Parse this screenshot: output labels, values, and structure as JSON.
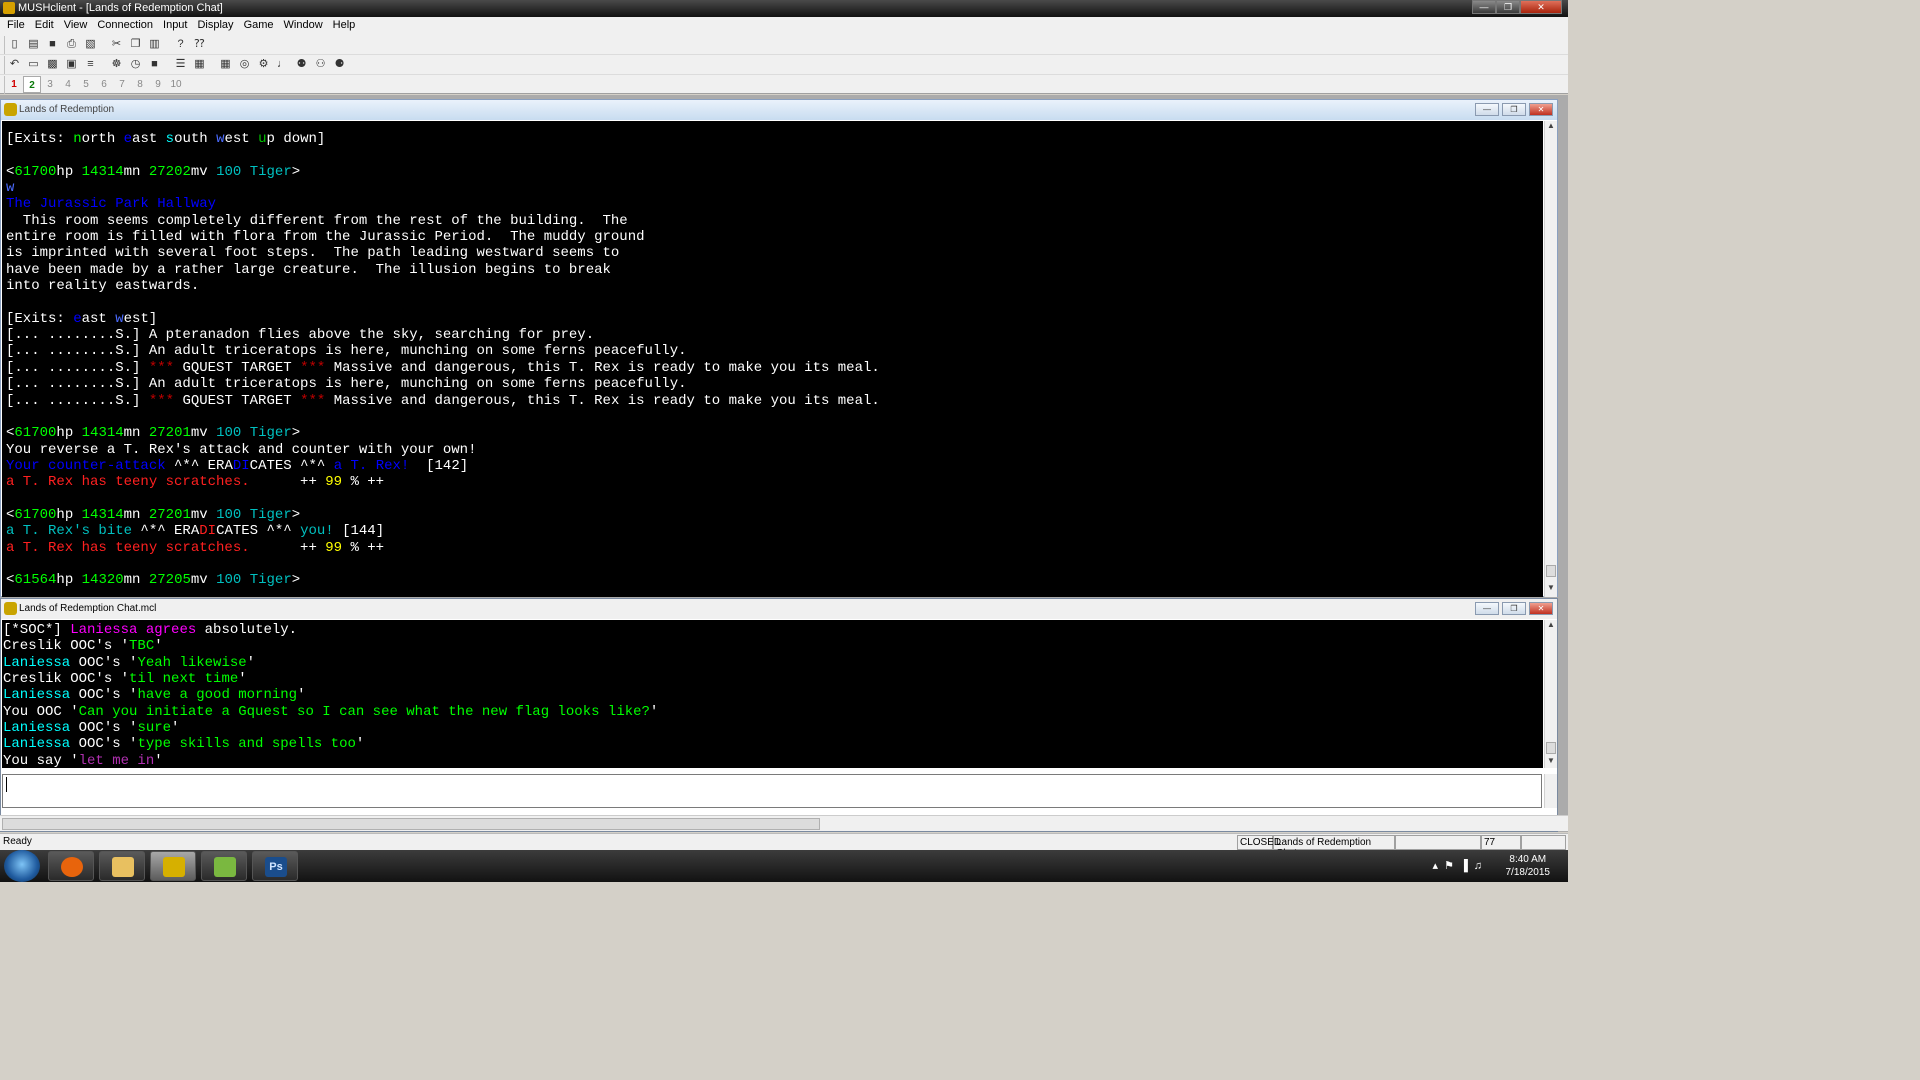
{
  "window": {
    "title": "MUSHclient - [Lands of Redemption Chat]"
  },
  "menu": [
    "File",
    "Edit",
    "View",
    "Connection",
    "Input",
    "Display",
    "Game",
    "Window",
    "Help"
  ],
  "toolbar": {
    "row1_icons": [
      "new-document-icon",
      "open-folder-icon",
      "save-icon",
      "print-icon",
      "print-preview-icon",
      "cut-icon",
      "copy-icon",
      "paste-icon",
      "help-icon",
      "context-help-icon"
    ],
    "row2_icons": [
      "connect-icon",
      "notepad-icon",
      "log-icon",
      "configure-icon",
      "triggers-icon",
      "aliases-icon",
      "timers-icon",
      "immediate-icon",
      "scripts-icon",
      "output-icon",
      "reset-icon",
      "info-icon",
      "world-icon",
      "sound-icon",
      "find-icon",
      "find-again-icon",
      "map-icon"
    ]
  },
  "world_tabs": [
    "1",
    "2",
    "3",
    "4",
    "5",
    "6",
    "7",
    "8",
    "9",
    "10"
  ],
  "world_window": {
    "title": "Lands of Redemption",
    "lines": [
      [
        {
          "t": "[Exits: ",
          "c": "w"
        },
        {
          "t": "n",
          "c": "lg"
        },
        {
          "t": "orth ",
          "c": "w"
        },
        {
          "t": "e",
          "c": "bl"
        },
        {
          "t": "ast ",
          "c": "w"
        },
        {
          "t": "s",
          "c": "lc"
        },
        {
          "t": "outh ",
          "c": "w"
        },
        {
          "t": "w",
          "c": "lb"
        },
        {
          "t": "est ",
          "c": "w"
        },
        {
          "t": "u",
          "c": "gr"
        },
        {
          "t": "p ",
          "c": "w"
        },
        {
          "t": "d",
          "c": "w"
        },
        {
          "t": "own]",
          "c": "w"
        }
      ],
      [],
      [
        {
          "t": "<",
          "c": "w"
        },
        {
          "t": "61700",
          "c": "lg"
        },
        {
          "t": "hp ",
          "c": "w"
        },
        {
          "t": "14314",
          "c": "lg"
        },
        {
          "t": "mn ",
          "c": "w"
        },
        {
          "t": "27202",
          "c": "lg"
        },
        {
          "t": "mv ",
          "c": "w"
        },
        {
          "t": "100 Tiger",
          "c": "cy"
        },
        {
          "t": ">",
          "c": "w"
        }
      ],
      [
        {
          "t": "w",
          "c": "lb"
        }
      ],
      [
        {
          "t": "The Jurassic Park Hallway",
          "c": "bl"
        }
      ],
      [
        {
          "t": "  This room seems completely different from the rest of the building.  The",
          "c": "w"
        }
      ],
      [
        {
          "t": "entire room is filled with flora from the Jurassic Period.  The muddy ground",
          "c": "w"
        }
      ],
      [
        {
          "t": "is imprinted with several foot steps.  The path leading westward seems to",
          "c": "w"
        }
      ],
      [
        {
          "t": "have been made by a rather large creature.  The illusion begins to break",
          "c": "w"
        }
      ],
      [
        {
          "t": "into reality eastwards.",
          "c": "w"
        }
      ],
      [],
      [
        {
          "t": "[Exits: ",
          "c": "w"
        },
        {
          "t": "e",
          "c": "bl"
        },
        {
          "t": "ast ",
          "c": "w"
        },
        {
          "t": "w",
          "c": "lb"
        },
        {
          "t": "est]",
          "c": "w"
        }
      ],
      [
        {
          "t": "[... ........S.] A pteranadon flies above the sky, searching for prey.",
          "c": "w"
        }
      ],
      [
        {
          "t": "[... ........S.] An adult triceratops is here, munching on some ferns peacefully.",
          "c": "w"
        }
      ],
      [
        {
          "t": "[... ........S.] ",
          "c": "w"
        },
        {
          "t": "***",
          "c": "dr"
        },
        {
          "t": " GQUEST TARGET ",
          "c": "w"
        },
        {
          "t": "***",
          "c": "dr"
        },
        {
          "t": " Massive and dangerous, this T. Rex is ready to make you its meal.",
          "c": "w"
        }
      ],
      [
        {
          "t": "[... ........S.] An adult triceratops is here, munching on some ferns peacefully.",
          "c": "w"
        }
      ],
      [
        {
          "t": "[... ........S.] ",
          "c": "w"
        },
        {
          "t": "***",
          "c": "dr"
        },
        {
          "t": " GQUEST TARGET ",
          "c": "w"
        },
        {
          "t": "***",
          "c": "dr"
        },
        {
          "t": " Massive and dangerous, this T. Rex is ready to make you its meal.",
          "c": "w"
        }
      ],
      [],
      [
        {
          "t": "<",
          "c": "w"
        },
        {
          "t": "61700",
          "c": "lg"
        },
        {
          "t": "hp ",
          "c": "w"
        },
        {
          "t": "14314",
          "c": "lg"
        },
        {
          "t": "mn ",
          "c": "w"
        },
        {
          "t": "27201",
          "c": "lg"
        },
        {
          "t": "mv ",
          "c": "w"
        },
        {
          "t": "100 Tiger",
          "c": "cy"
        },
        {
          "t": ">",
          "c": "w"
        }
      ],
      [
        {
          "t": "You reverse a T. Rex's attack and counter with your own!",
          "c": "w"
        }
      ],
      [
        {
          "t": "Your counter-attack ",
          "c": "bl"
        },
        {
          "t": "^*^ ",
          "c": "w"
        },
        {
          "t": "ERA",
          "c": "w"
        },
        {
          "t": "DI",
          "c": "bl"
        },
        {
          "t": "CATES",
          "c": "w"
        },
        {
          "t": " ^*^ ",
          "c": "w"
        },
        {
          "t": "a T. Rex!",
          "c": "bl"
        },
        {
          "t": "  [142]",
          "c": "w"
        }
      ],
      [
        {
          "t": "a T. Rex has teeny scratches.",
          "c": "rd"
        },
        {
          "t": "      ++ ",
          "c": "w"
        },
        {
          "t": "99",
          "c": "yl"
        },
        {
          "t": " % ++",
          "c": "w"
        }
      ],
      [],
      [
        {
          "t": "<",
          "c": "w"
        },
        {
          "t": "61700",
          "c": "lg"
        },
        {
          "t": "hp ",
          "c": "w"
        },
        {
          "t": "14314",
          "c": "lg"
        },
        {
          "t": "mn ",
          "c": "w"
        },
        {
          "t": "27201",
          "c": "lg"
        },
        {
          "t": "mv ",
          "c": "w"
        },
        {
          "t": "100 Tiger",
          "c": "cy"
        },
        {
          "t": ">",
          "c": "w"
        }
      ],
      [
        {
          "t": "a T. Rex's bite ",
          "c": "cy"
        },
        {
          "t": "^*^ ",
          "c": "w"
        },
        {
          "t": "ERA",
          "c": "w"
        },
        {
          "t": "DI",
          "c": "rd"
        },
        {
          "t": "CATES",
          "c": "w"
        },
        {
          "t": " ^*^ ",
          "c": "w"
        },
        {
          "t": "you!",
          "c": "cy"
        },
        {
          "t": " [144]",
          "c": "w"
        }
      ],
      [
        {
          "t": "a T. Rex has teeny scratches.",
          "c": "rd"
        },
        {
          "t": "      ++ ",
          "c": "w"
        },
        {
          "t": "99",
          "c": "yl"
        },
        {
          "t": " % ++",
          "c": "w"
        }
      ],
      [],
      [
        {
          "t": "<",
          "c": "w"
        },
        {
          "t": "61564",
          "c": "lg"
        },
        {
          "t": "hp ",
          "c": "w"
        },
        {
          "t": "14320",
          "c": "lg"
        },
        {
          "t": "mn ",
          "c": "w"
        },
        {
          "t": "27205",
          "c": "lg"
        },
        {
          "t": "mv ",
          "c": "w"
        },
        {
          "t": "100 Tiger",
          "c": "cy"
        },
        {
          "t": ">",
          "c": "w"
        }
      ]
    ]
  },
  "chat_window": {
    "title": "Lands of Redemption Chat.mcl",
    "lines": [
      [
        {
          "t": "[*SOC*] ",
          "c": "w"
        },
        {
          "t": "Laniessa",
          "c": "mg"
        },
        {
          "t": " agrees ",
          "c": "mg"
        },
        {
          "t": "absolutely.",
          "c": "w"
        }
      ],
      [
        {
          "t": "Creslik OOC's '",
          "c": "w"
        },
        {
          "t": "TBC",
          "c": "lg"
        },
        {
          "t": "'",
          "c": "w"
        }
      ],
      [
        {
          "t": "Laniessa",
          "c": "lc"
        },
        {
          "t": " OOC's '",
          "c": "w"
        },
        {
          "t": "Yeah likewise",
          "c": "lg"
        },
        {
          "t": "'",
          "c": "w"
        }
      ],
      [
        {
          "t": "Creslik OOC's '",
          "c": "w"
        },
        {
          "t": "til next time",
          "c": "lg"
        },
        {
          "t": "'",
          "c": "w"
        }
      ],
      [
        {
          "t": "Laniessa",
          "c": "lc"
        },
        {
          "t": " OOC's '",
          "c": "w"
        },
        {
          "t": "have a good morning",
          "c": "lg"
        },
        {
          "t": "'",
          "c": "w"
        }
      ],
      [
        {
          "t": "You OOC '",
          "c": "w"
        },
        {
          "t": "Can you initiate a Gquest so I can see what the new flag looks like?",
          "c": "lg"
        },
        {
          "t": "'",
          "c": "w"
        }
      ],
      [
        {
          "t": "Laniessa",
          "c": "lc"
        },
        {
          "t": " OOC's '",
          "c": "w"
        },
        {
          "t": "sure",
          "c": "lg"
        },
        {
          "t": "'",
          "c": "w"
        }
      ],
      [
        {
          "t": "Laniessa",
          "c": "lc"
        },
        {
          "t": " OOC's '",
          "c": "w"
        },
        {
          "t": "type skills and spells too",
          "c": "lg"
        },
        {
          "t": "'",
          "c": "w"
        }
      ],
      [
        {
          "t": "You say '",
          "c": "w"
        },
        {
          "t": "let me in",
          "c": "pm"
        },
        {
          "t": "'",
          "c": "w"
        }
      ]
    ]
  },
  "command_input": {
    "value": ""
  },
  "status": {
    "ready": "Ready",
    "connection": "CLOSED",
    "world": "Lands of Redemption Chat",
    "lines": "77"
  },
  "taskbar": {
    "apps": [
      {
        "name": "firefox",
        "color": "#e8640c"
      },
      {
        "name": "explorer",
        "color": "#e8c060"
      },
      {
        "name": "mushclient",
        "color": "#d6b000"
      },
      {
        "name": "notepad",
        "color": "#7ab840"
      },
      {
        "name": "photoshop",
        "color": "#1a4d8c"
      }
    ],
    "photoshop_label": "Ps",
    "time": "8:40 AM",
    "date": "7/18/2015"
  }
}
